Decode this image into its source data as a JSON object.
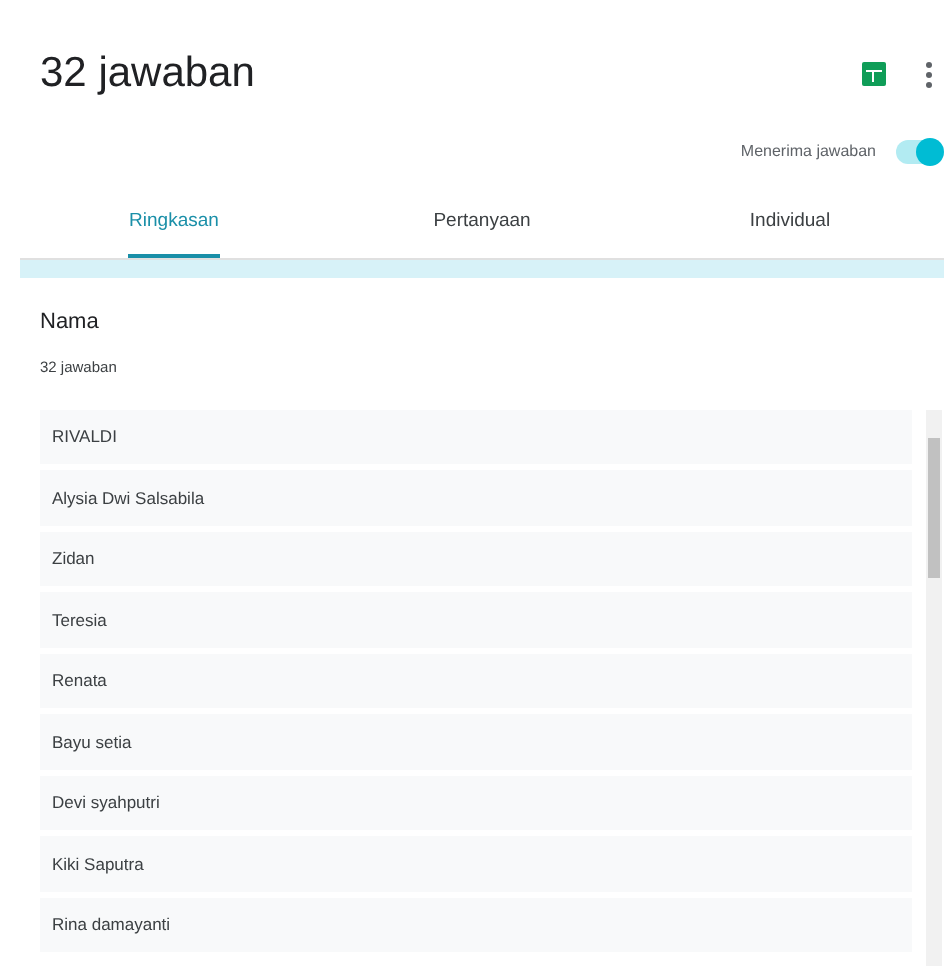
{
  "header": {
    "title": "32 jawaban"
  },
  "accepting": {
    "label": "Menerima jawaban",
    "on": true
  },
  "tabs": [
    {
      "label": "Ringkasan",
      "selected": true
    },
    {
      "label": "Pertanyaan",
      "selected": false
    },
    {
      "label": "Individual",
      "selected": false
    }
  ],
  "question": {
    "title": "Nama",
    "count": "32 jawaban"
  },
  "answers": [
    "RIVALDI",
    "Alysia Dwi Salsabila",
    "Zidan",
    "Teresia",
    "Renata",
    "Bayu setia",
    "Devi syahputri",
    "Kiki Saputra",
    "Rina damayanti"
  ]
}
